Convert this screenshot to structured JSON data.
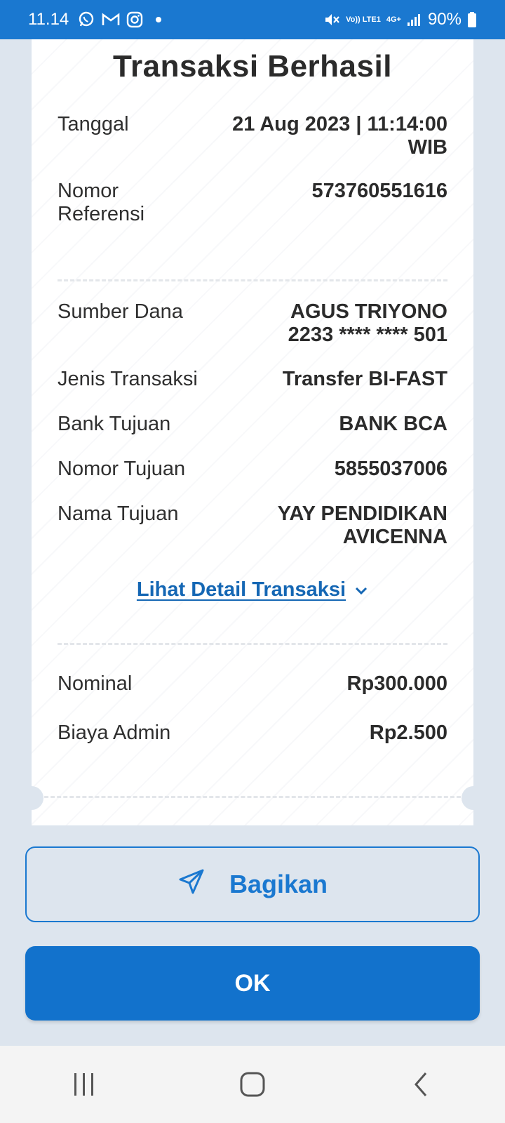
{
  "status_bar": {
    "time": "11.14",
    "network_small_1": "Vo)) LTE1",
    "network_small_2": "4G+",
    "battery_percent": "90%",
    "icons": [
      "whatsapp-icon",
      "gmail-icon",
      "instagram-icon",
      "mute-icon",
      "signal-icon",
      "battery-icon"
    ]
  },
  "receipt": {
    "title": "Transaksi Berhasil",
    "rows_top": [
      {
        "label": "Tanggal",
        "value": "21 Aug 2023 | 11:14:00\nWIB"
      },
      {
        "label": "Nomor\nReferensi",
        "value": "573760551616"
      }
    ],
    "rows_mid": [
      {
        "label": "Sumber Dana",
        "value": "AGUS TRIYONO\n2233 **** **** 501"
      },
      {
        "label": "Jenis Transaksi",
        "value": "Transfer BI-FAST"
      },
      {
        "label": "Bank Tujuan",
        "value": "BANK BCA"
      },
      {
        "label": "Nomor Tujuan",
        "value": "5855037006"
      },
      {
        "label": "Nama Tujuan",
        "value": "YAY PENDIDIKAN\nAVICENNA"
      }
    ],
    "detail_link": "Lihat Detail Transaksi",
    "rows_bottom": [
      {
        "label": "Nominal",
        "value": "Rp300.000"
      },
      {
        "label": "Biaya Admin",
        "value": "Rp2.500"
      }
    ]
  },
  "actions": {
    "share_label": "Bagikan",
    "ok_label": "OK"
  },
  "colors": {
    "primary": "#1a78d0",
    "background": "#dde5ee",
    "link": "#1567b4"
  }
}
